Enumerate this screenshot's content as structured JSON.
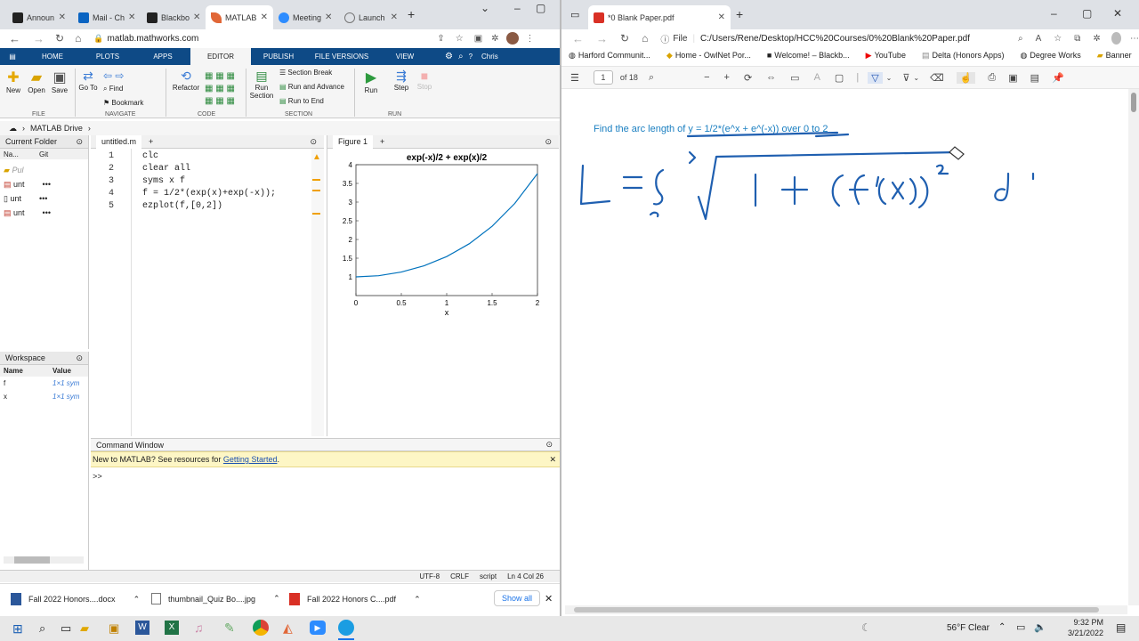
{
  "left_browser": {
    "tabs": [
      {
        "label": "Announ",
        "icon": "blackboard-icon"
      },
      {
        "label": "Mail - Ch",
        "icon": "outlook-icon"
      },
      {
        "label": "Blackbo",
        "icon": "blackboard-icon"
      },
      {
        "label": "MATLAB",
        "icon": "matlab-icon"
      },
      {
        "label": "Meeting",
        "icon": "zoom-icon"
      },
      {
        "label": "Launch",
        "icon": "globe-icon"
      }
    ],
    "url": "matlab.mathworks.com"
  },
  "matlab": {
    "toolstrip_tabs": [
      "HOME",
      "PLOTS",
      "APPS",
      "EDITOR",
      "PUBLISH",
      "FILE VERSIONS",
      "VIEW"
    ],
    "user": "Chris",
    "ribbon": {
      "new": "New",
      "open": "Open",
      "save": "Save",
      "go_to": "Go To",
      "find": "Find",
      "bookmark": "Bookmark",
      "refactor": "Refactor",
      "run_section": "Run Section",
      "section_break": "Section Break",
      "run_advance": "Run and Advance",
      "run_end": "Run to End",
      "run": "Run",
      "step": "Step",
      "stop": "Stop",
      "groups": {
        "file": "FILE",
        "navigate": "NAVIGATE",
        "code": "CODE",
        "section": "SECTION",
        "run": "RUN"
      }
    },
    "path": "MATLAB Drive",
    "current_folder": {
      "title": "Current Folder",
      "col_name": "Na...",
      "col_git": "Git",
      "items": [
        "Pul",
        "unt",
        "unt",
        "unt"
      ]
    },
    "workspace": {
      "title": "Workspace",
      "col_name": "Name",
      "col_value": "Value",
      "rows": [
        {
          "name": "f",
          "value": "1×1 sym"
        },
        {
          "name": "x",
          "value": "1×1 sym"
        }
      ]
    },
    "editor": {
      "tab": "untitled.m",
      "lines": [
        {
          "num": "1",
          "text": "clc"
        },
        {
          "num": "2",
          "text": "clear all"
        },
        {
          "num": "3",
          "text": "syms x f"
        },
        {
          "num": "4",
          "text": "f = 1/2*(exp(x)+exp(-x));"
        },
        {
          "num": "5",
          "text": "ezplot(f,[0,2])"
        }
      ]
    },
    "figure": {
      "tab": "Figure 1"
    },
    "command_window": {
      "title": "Command Window",
      "notice": "New to MATLAB? See resources for ",
      "notice_link": "Getting Started",
      "notice_end": ".",
      "prompt": ">>"
    },
    "status": {
      "encoding": "UTF-8",
      "eol": "CRLF",
      "type": "script",
      "position": "Ln 4 Col 26"
    }
  },
  "chart_data": {
    "type": "line",
    "title": "exp(-x)/2 + exp(x)/2",
    "xlabel": "x",
    "ylabel": "",
    "xlim": [
      0,
      2
    ],
    "ylim": [
      0.5,
      4
    ],
    "xticks": [
      "0",
      "0.5",
      "1",
      "1.5",
      "2"
    ],
    "yticks": [
      "1",
      "1.5",
      "2",
      "2.5",
      "3",
      "3.5",
      "4"
    ],
    "series": [
      {
        "x": [
          0,
          0.25,
          0.5,
          0.75,
          1.0,
          1.25,
          1.5,
          1.75,
          2.0
        ],
        "y": [
          1.0,
          1.031,
          1.128,
          1.295,
          1.543,
          1.888,
          2.352,
          2.964,
          3.762
        ]
      }
    ],
    "color": "#0072bd"
  },
  "downloads": {
    "items": [
      {
        "name": "Fall 2022 Honors....docx",
        "icon": "word-doc-icon"
      },
      {
        "name": "thumbnail_Quiz Bo....jpg",
        "icon": "image-file-icon"
      },
      {
        "name": "Fall 2022 Honors C....pdf",
        "icon": "pdf-file-icon"
      }
    ],
    "show_all": "Show all"
  },
  "right_browser": {
    "tab": "*0 Blank Paper.pdf",
    "file_label": "File",
    "url": "C:/Users/Rene/Desktop/HCC%20Courses/0%20Blank%20Paper.pdf",
    "bookmarks": [
      {
        "label": "Harford Communit...",
        "icon": "globe-icon"
      },
      {
        "label": "Home - OwlNet Por...",
        "icon": "owl-icon"
      },
      {
        "label": "Welcome! – Blackb...",
        "icon": "blackboard-icon"
      },
      {
        "label": "YouTube",
        "icon": "youtube-icon"
      },
      {
        "label": "Delta (Honors Apps)",
        "icon": "document-icon"
      },
      {
        "label": "Degree Works",
        "icon": "globe-icon"
      },
      {
        "label": "Banner",
        "icon": "folder-icon"
      }
    ],
    "pdf": {
      "page": "1",
      "of": "of 18",
      "prompt_prefix": "Find the arc length of ",
      "prompt_func": "y = 1/2*(e^x + e^(-x))",
      "prompt_mid": " over ",
      "prompt_range": "0 to 2"
    }
  },
  "taskbar": {
    "weather": "56°F  Clear",
    "time": "9:32 PM",
    "date": "3/21/2022"
  }
}
